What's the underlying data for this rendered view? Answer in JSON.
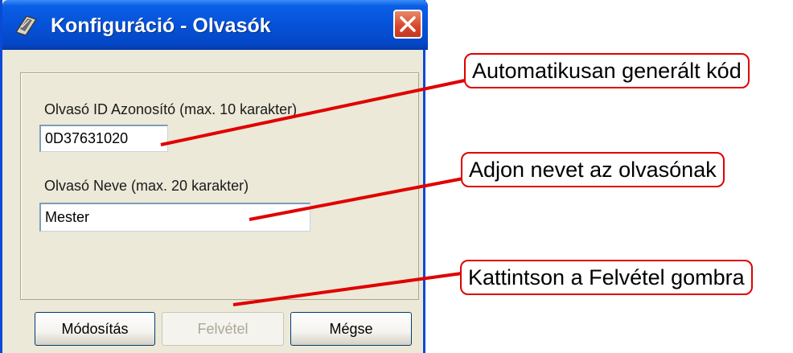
{
  "window": {
    "title": "Konfiguráció - Olvasók",
    "icon": "app-icon",
    "close_icon": "close-icon"
  },
  "form": {
    "reader_id_label": "Olvasó ID Azonosító (max. 10 karakter)",
    "reader_id_value": "0D37631020",
    "reader_name_label": "Olvasó Neve (max. 20 karakter)",
    "reader_name_value": "Mester"
  },
  "buttons": {
    "modify_label": "Módosítás",
    "add_label": "Felvétel",
    "cancel_label": "Mégse"
  },
  "annotations": {
    "auto_code": "Automatikusan generált kód",
    "give_name": "Adjon nevet az olvasónak",
    "click_add": "Kattintson a Felvétel gombra"
  },
  "colors": {
    "titlebar": "#0552d9",
    "annotation": "#e00000",
    "dialog_bg": "#ece9d8"
  }
}
